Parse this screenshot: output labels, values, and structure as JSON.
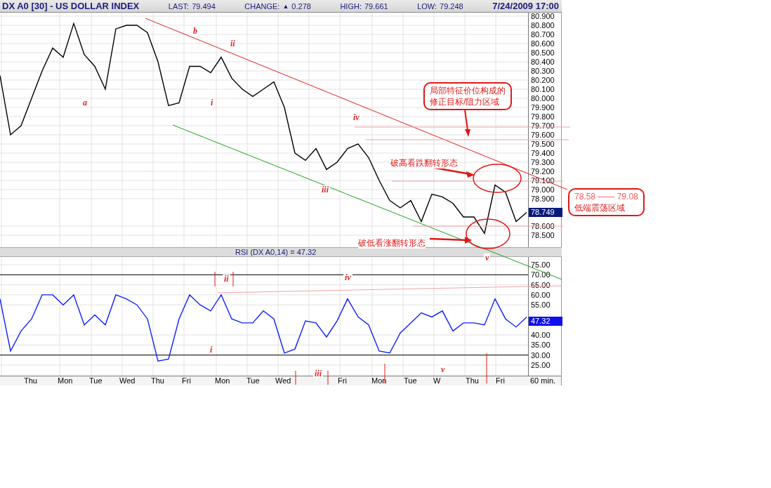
{
  "header": {
    "symbol": "DX A0 [30] - US DOLLAR INDEX",
    "stats": [
      {
        "label": "LAST:",
        "value": "79.494"
      },
      {
        "label": "CHANGE:",
        "arrow": "▲",
        "value": "0.278"
      },
      {
        "label": "HIGH:",
        "value": "79.661"
      },
      {
        "label": "LOW:",
        "value": "79.248"
      }
    ],
    "datetime": "7/24/2009 17:00"
  },
  "price_panel": {
    "current_price": "78.749",
    "wave_labels": [
      "a",
      "b",
      "i",
      "ii",
      "iii",
      "iv",
      "v"
    ],
    "chart_data": {
      "type": "line",
      "grid": true,
      "ylim": [
        78.5,
        80.9
      ],
      "yticks": [
        {
          "value": 80.9,
          "label": "80.900"
        },
        {
          "value": 80.8,
          "label": "80.800"
        },
        {
          "value": 80.7,
          "label": "80.700"
        },
        {
          "value": 80.6,
          "label": "80.600"
        },
        {
          "value": 80.5,
          "label": "80.500"
        },
        {
          "value": 80.4,
          "label": "80.400"
        },
        {
          "value": 80.3,
          "label": "80.300"
        },
        {
          "value": 80.2,
          "label": "80.200"
        },
        {
          "value": 80.1,
          "label": "80.100"
        },
        {
          "value": 80.0,
          "label": "80.000"
        },
        {
          "value": 79.9,
          "label": "79.900"
        },
        {
          "value": 79.8,
          "label": "79.800"
        },
        {
          "value": 79.7,
          "label": "79.700"
        },
        {
          "value": 79.6,
          "label": "79.600"
        },
        {
          "value": 79.5,
          "label": "79.500"
        },
        {
          "value": 79.4,
          "label": "79.400"
        },
        {
          "value": 79.3,
          "label": "79.300"
        },
        {
          "value": 79.2,
          "label": "79.200"
        },
        {
          "value": 79.1,
          "label": "79.100"
        },
        {
          "value": 79.0,
          "label": "79.000"
        },
        {
          "value": 78.9,
          "label": "78.900"
        },
        {
          "value": 78.6,
          "label": "78.600"
        },
        {
          "value": 78.5,
          "label": "78.500"
        }
      ],
      "categories": [
        null,
        null,
        null,
        null,
        null,
        null,
        null,
        null,
        null,
        null,
        null,
        null,
        null,
        null,
        null,
        null,
        null,
        null,
        null,
        null,
        null,
        null,
        null,
        null,
        null,
        null,
        null,
        null,
        null,
        null,
        null,
        null,
        null,
        null,
        null,
        null,
        null,
        null,
        null,
        null,
        null,
        null,
        null,
        null,
        null,
        null,
        null,
        null,
        null,
        null,
        null
      ],
      "series": [
        {
          "color": "#000000",
          "values": [
            80.25,
            79.6,
            79.7,
            80.0,
            80.3,
            80.55,
            80.45,
            80.82,
            80.48,
            80.35,
            80.1,
            80.76,
            80.8,
            80.8,
            80.72,
            80.4,
            79.92,
            79.95,
            80.35,
            80.35,
            80.28,
            80.45,
            80.22,
            80.1,
            80.02,
            80.1,
            80.18,
            79.9,
            79.4,
            79.32,
            79.45,
            79.22,
            79.3,
            79.45,
            79.5,
            79.35,
            79.1,
            78.88,
            78.8,
            78.88,
            78.65,
            78.95,
            78.92,
            78.85,
            78.7,
            78.7,
            78.52,
            79.05,
            78.97,
            78.65,
            78.75
          ]
        }
      ]
    }
  },
  "rsi_panel": {
    "title": "RSI (DX A0,14) = 47.32",
    "current_value": "47.32",
    "wave_labels": [
      "i",
      "ii",
      "iii",
      "iv",
      "v"
    ],
    "chart_data": {
      "type": "line",
      "grid": true,
      "ylim": [
        25,
        75
      ],
      "yticks": [
        {
          "value": 75,
          "label": "75.00"
        },
        {
          "value": 70,
          "label": "70.00"
        },
        {
          "value": 65,
          "label": "65.00"
        },
        {
          "value": 60,
          "label": "60.00"
        },
        {
          "value": 55,
          "label": "55.00"
        },
        {
          "value": 40,
          "label": "40.00"
        },
        {
          "value": 35,
          "label": "35.00"
        },
        {
          "value": 30,
          "label": "30.00"
        },
        {
          "value": 25,
          "label": "25.00"
        }
      ],
      "categories": [
        null,
        null,
        null,
        null,
        null,
        null,
        null,
        null,
        null,
        null,
        null,
        null,
        null,
        null,
        null,
        null,
        null,
        null,
        null,
        null,
        null,
        null,
        null,
        null,
        null,
        null,
        null,
        null,
        null,
        null,
        null,
        null,
        null,
        null,
        null,
        null,
        null,
        null,
        null,
        null,
        null,
        null,
        null,
        null,
        null,
        null,
        null,
        null,
        null,
        null,
        null
      ],
      "series": [
        {
          "color": "#1020ff",
          "values": [
            58,
            32,
            42,
            48,
            60,
            60,
            55,
            60,
            45,
            50,
            45,
            60,
            58,
            55,
            48,
            27,
            28,
            48,
            60,
            55,
            52,
            60,
            48,
            46,
            46,
            52,
            48,
            31,
            33,
            47,
            46,
            39,
            47,
            58,
            49,
            45,
            32,
            31,
            41,
            46,
            51,
            49,
            52,
            42,
            46,
            46,
            45,
            58,
            48,
            44,
            49
          ]
        }
      ]
    }
  },
  "x_axis": {
    "labels": [
      "Thu",
      "Mon",
      "Tue",
      "Wed",
      "Thu",
      "Fri",
      "Mon",
      "Tue",
      "Wed",
      "Fri",
      "Mon",
      "Tue",
      "W",
      "Thu",
      "Fri"
    ],
    "interval": "60 min."
  },
  "annotations": [
    {
      "kind": "callout",
      "lines": [
        "局部特征价位构成的",
        "修正目标/阻力区域"
      ]
    },
    {
      "kind": "note",
      "lines": [
        "破高看跌翻转形态"
      ]
    },
    {
      "kind": "note",
      "lines": [
        "破低看涨翻转形态"
      ]
    },
    {
      "kind": "range",
      "lines": [
        "78.58 —— 79.08",
        "低端震荡区域"
      ]
    }
  ]
}
